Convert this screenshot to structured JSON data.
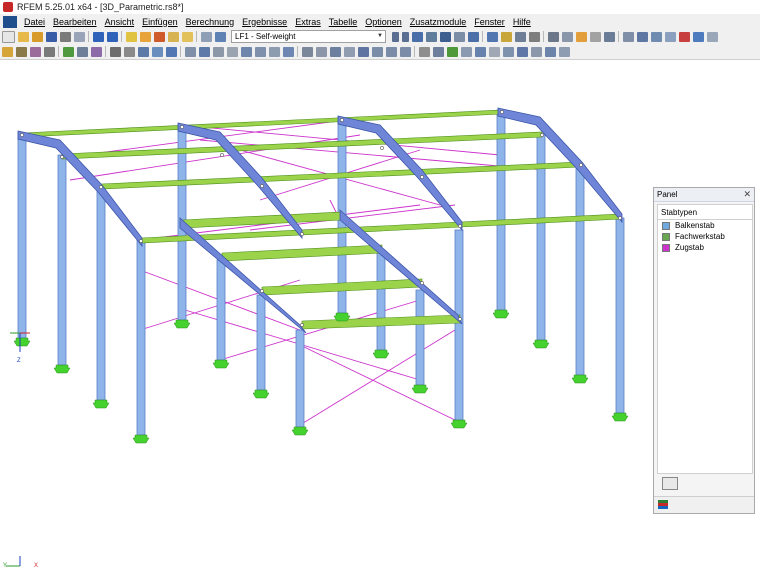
{
  "window": {
    "title": "RFEM 5.25.01 x64 - [3D_Parametric.rs8*]"
  },
  "menu": [
    "Datei",
    "Bearbeiten",
    "Ansicht",
    "Einfügen",
    "Berechnung",
    "Ergebnisse",
    "Extras",
    "Tabelle",
    "Optionen",
    "Zusatzmodule",
    "Fenster",
    "Hilfe"
  ],
  "toolbar": {
    "load_case": "LF1 - Self-weight"
  },
  "panel": {
    "title": "Panel",
    "close_glyph": "✕",
    "group_title": "Stabtypen",
    "legend": [
      {
        "label": "Balkenstab",
        "color": "#6fa8dc"
      },
      {
        "label": "Fachwerkstab",
        "color": "#6aa84f"
      },
      {
        "label": "Zugstab",
        "color": "#cc33cc"
      }
    ]
  },
  "axes": {
    "global_z": "Z",
    "corner_x": "X",
    "corner_y": "Y"
  },
  "colors": {
    "column": "#8fb4ea",
    "rafter": "#6f86d8",
    "purlin": "#9bd34a",
    "bracing": "#cc33cc",
    "support": "#45d12e",
    "node": "#ffffff",
    "node_stroke": "#555555"
  },
  "icons": {
    "app": "rfem-icon",
    "panel_footer": "color-scale-icon",
    "panel_button": "panel-settings-icon"
  }
}
